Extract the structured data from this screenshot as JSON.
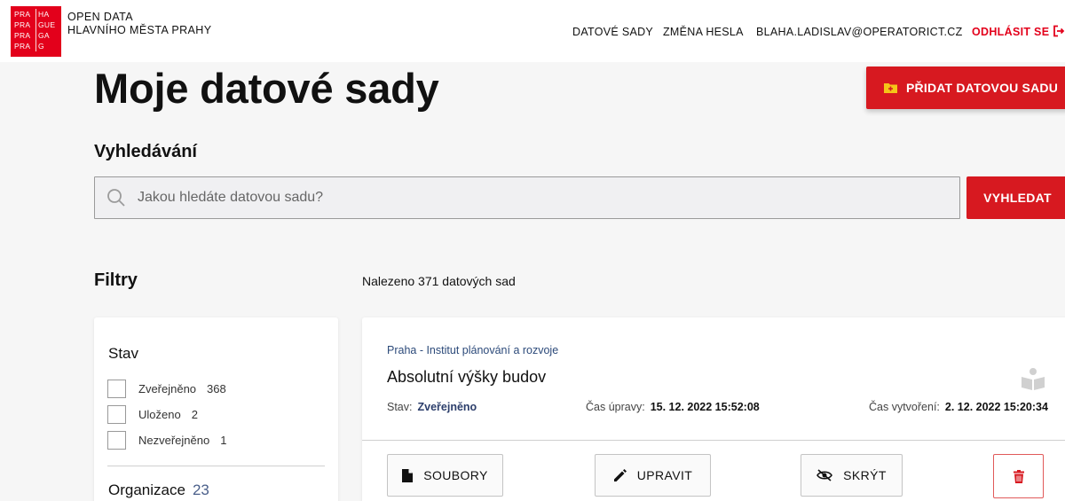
{
  "header": {
    "logo_rows": [
      [
        "PRA",
        "HA"
      ],
      [
        "PRA",
        "GUE"
      ],
      [
        "PRA",
        "GA"
      ],
      [
        "PRA",
        "G"
      ]
    ],
    "site_title_line1": "OPEN DATA",
    "site_title_line2": "HLAVNÍHO MĚSTA PRAHY",
    "nav": {
      "datasets": "DATOVÉ SADY",
      "change_password": "ZMĚNA HESLA",
      "user_email": "BLAHA.LADISLAV@OPERATORICT.CZ",
      "logout": "ODHLÁSIT SE"
    }
  },
  "page": {
    "title": "Moje datové sady",
    "add_dataset_label": "PŘIDAT DATOVOU SADU"
  },
  "search": {
    "title": "Vyhledávání",
    "placeholder": "Jakou hledáte datovou sadu?",
    "value": "",
    "button_label": "VYHLEDAT"
  },
  "filters": {
    "title": "Filtry",
    "status_heading": "Stav",
    "status_options": [
      {
        "label": "Zveřejněno",
        "count": "368"
      },
      {
        "label": "Uloženo",
        "count": "2"
      },
      {
        "label": "Nezveřejněno",
        "count": "1"
      }
    ],
    "organization_heading": "Organizace",
    "organization_count": "23"
  },
  "results": {
    "count_text": "Nalezeno 371 datových sad",
    "items": [
      {
        "publisher": "Praha - Institut plánování a rozvoje",
        "title": "Absolutní výšky budov",
        "status_label": "Stav:",
        "status_value": "Zveřejněno",
        "modified_label": "Čas úpravy:",
        "modified_value": "15. 12. 2022 15:52:08",
        "created_label": "Čas vytvoření:",
        "created_value": "2. 12. 2022 15:20:34",
        "actions": {
          "files": "SOUBORY",
          "edit": "UPRAVIT",
          "hide": "SKRÝT"
        }
      }
    ]
  },
  "colors": {
    "brand_red": "#d71920",
    "logo_red": "#e3001b",
    "link_blue": "#2c4a7a",
    "background": "#f6f6f6"
  },
  "icons": [
    "logout-icon",
    "folder-plus-icon",
    "search-icon",
    "book-icon",
    "file-icon",
    "pencil-icon",
    "eye-off-icon",
    "trash-icon"
  ]
}
